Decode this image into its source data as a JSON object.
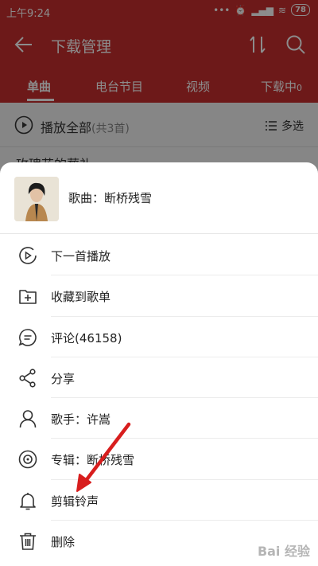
{
  "status_bar": {
    "time": "上午9:24",
    "battery": "78"
  },
  "header": {
    "title": "下载管理"
  },
  "tabs": [
    {
      "label": "单曲"
    },
    {
      "label": "电台节目"
    },
    {
      "label": "视频"
    },
    {
      "label": "下载中",
      "badge": "0"
    }
  ],
  "list": {
    "play_all": "播放全部",
    "count": "(共3首)",
    "multi_select": "多选",
    "first_song_peek": "玫瑰花的葬礼"
  },
  "sheet": {
    "title": "歌曲：断桥残雪",
    "items": [
      {
        "label": "下一首播放",
        "icon": "play-next-icon"
      },
      {
        "label": "收藏到歌单",
        "icon": "add-to-playlist-icon"
      },
      {
        "label": "评论(46158)",
        "icon": "comment-icon"
      },
      {
        "label": "分享",
        "icon": "share-icon"
      },
      {
        "label": "歌手：许嵩",
        "icon": "artist-icon"
      },
      {
        "label": "专辑：断桥残雪",
        "icon": "album-icon"
      },
      {
        "label": "剪辑铃声",
        "icon": "bell-icon"
      },
      {
        "label": "删除",
        "icon": "trash-icon"
      }
    ]
  },
  "watermark": "Bai 经验",
  "colors": {
    "brand_red": "#c62f2f",
    "annotation_arrow": "#d81e1e"
  }
}
